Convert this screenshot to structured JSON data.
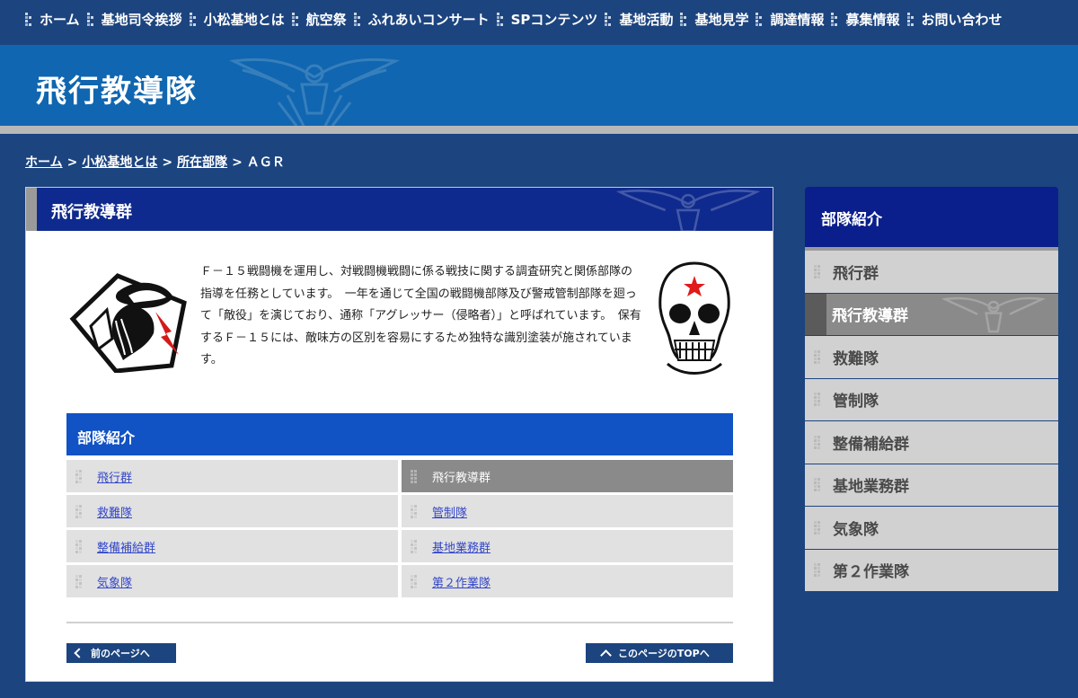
{
  "nav": {
    "items": [
      "ホーム",
      "基地司令挨拶",
      "小松基地とは",
      "航空祭",
      "ふれあいコンサート",
      "SPコンテンツ",
      "基地活動",
      "基地見学",
      "調達情報",
      "募集情報",
      "お問い合わせ"
    ]
  },
  "banner": {
    "title": "飛行教導隊"
  },
  "breadcrumb": {
    "home": "ホーム",
    "about": "小松基地とは",
    "units": "所在部隊",
    "current": "ＡＧＲ",
    "separator": ">"
  },
  "main": {
    "heading": "飛行教導群",
    "intro": "Ｆ－１５戦闘機を運用し、対戦闘機戦闘に係る戦技に関する調査研究と関係部隊の指導を任務としています。　一年を通じて全国の戦闘機部隊及び警戒管制部隊を廻って「敵役」を演じており、通称「アグレッサー（侵略者）」と呼ばれています。　保有するＦ－１５には、敵味方の区別を容易にするため独特な識別塗装が施されています。",
    "units_heading": "部隊紹介",
    "units": [
      {
        "label": "飛行群",
        "active": false
      },
      {
        "label": "飛行教導群",
        "active": true
      },
      {
        "label": "救難隊",
        "active": false
      },
      {
        "label": "管制隊",
        "active": false
      },
      {
        "label": "整備補給群",
        "active": false
      },
      {
        "label": "基地業務群",
        "active": false
      },
      {
        "label": "気象隊",
        "active": false
      },
      {
        "label": "第２作業隊",
        "active": false
      }
    ],
    "prev_button": "前のページへ",
    "top_button": "このページのTOPへ"
  },
  "sidebar": {
    "heading": "部隊紹介",
    "items": [
      {
        "label": "飛行群",
        "active": false
      },
      {
        "label": "飛行教導群",
        "active": true
      },
      {
        "label": "救難隊",
        "active": false
      },
      {
        "label": "管制隊",
        "active": false
      },
      {
        "label": "整備補給群",
        "active": false
      },
      {
        "label": "基地業務群",
        "active": false
      },
      {
        "label": "気象隊",
        "active": false
      },
      {
        "label": "第２作業隊",
        "active": false
      }
    ]
  },
  "colors": {
    "page_bg": "#1c447f",
    "banner": "#1066b0",
    "heading_navy": "#0f2a8e",
    "units_blue": "#1152c5",
    "link": "#3448c9",
    "skull_star": "#e01a1a",
    "snake_tongue": "#d41a1a"
  },
  "icons": {
    "emblem": "eagle-emblem-icon",
    "snake": "cobra-patch-icon",
    "skull": "skull-patch-icon"
  }
}
